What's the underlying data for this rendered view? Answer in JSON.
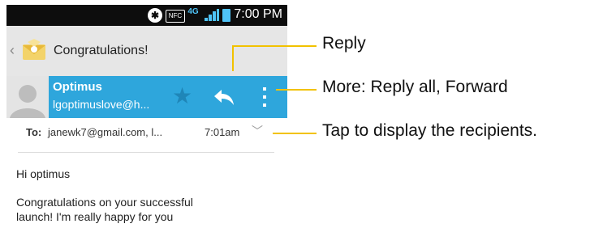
{
  "status_bar": {
    "time": "7:00 PM",
    "nfc_label": "NFC",
    "network_label": "4G",
    "bluetooth_glyph": "✱",
    "icons": [
      "bluetooth-icon",
      "nfc-icon",
      "network-4g-icon",
      "signal-icon",
      "battery-icon"
    ]
  },
  "action_bar": {
    "back_glyph": "‹",
    "subject": "Congratulations!",
    "app_icon": "email-app-icon"
  },
  "sender": {
    "name": "Optimus",
    "email": "lgoptimuslove@h...",
    "star_glyph": "★",
    "colors": {
      "bar": "#2ea6dc",
      "star": "#1f86b8"
    }
  },
  "recipients": {
    "to_label": "To:",
    "to_value": "janewk7@gmail.com, l...",
    "time": "7:01am",
    "expand_glyph": "﹀"
  },
  "message": {
    "greeting": "Hi optimus",
    "body_lines": [
      "Congratulations on your successful",
      "launch! I'm really happy for you"
    ]
  },
  "callouts": {
    "reply": "Reply",
    "more": "More: Reply all, Forward",
    "recipients": "Tap to display the recipients.",
    "color": "#f2c200"
  }
}
